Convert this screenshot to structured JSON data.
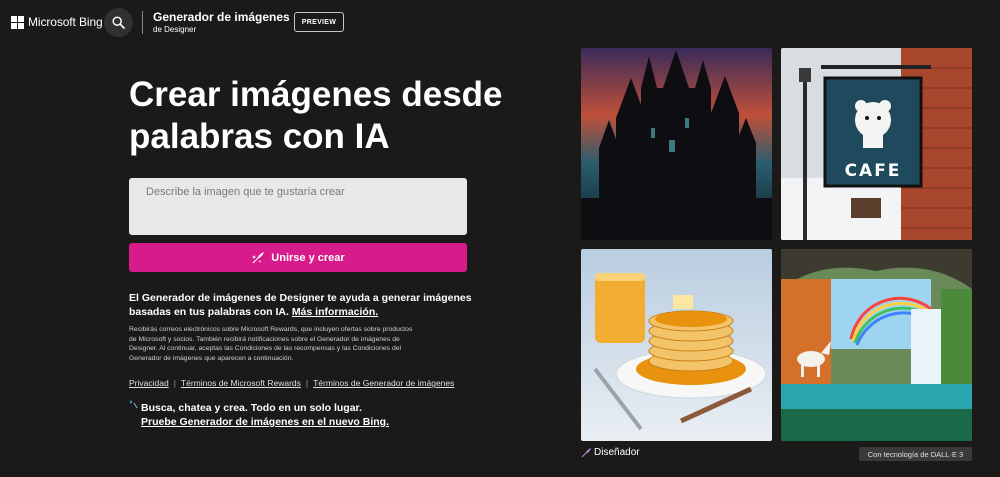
{
  "header": {
    "brand": "Microsoft Bing",
    "app_title": "Generador de imágenes",
    "app_subtitle": "de Designer",
    "preview_badge": "PREVIEW"
  },
  "hero": {
    "title": "Crear imágenes desde palabras con IA",
    "prompt_placeholder": "Describe la imagen que te gustaría crear",
    "join_button": "Unirse y crear"
  },
  "description": {
    "text": "El Generador de imágenes de Designer te ayuda a generar imágenes basadas en tus palabras con IA.",
    "link": "Más información."
  },
  "small_print": "Recibirás correos electrónicos sobre Microsoft Rewards, que incluyen ofertas sobre productos de Microsoft y socios. También recibirá notificaciones sobre el Generador de imágenes de Designer. Al continuar, aceptas las Condiciones de las recompensas y las Condiciones del Generador de imágenes que aparecen a continuación.",
  "footer_links": {
    "privacy": "Privacidad",
    "rewards_terms": "Términos de Microsoft Rewards",
    "generator_terms": "Términos de Generador de imágenes",
    "separator": "|"
  },
  "promo": {
    "line1": "Busca, chatea y crea. Todo en un solo lugar.",
    "line2": "Pruebe Generador de imágenes en el nuevo Bing."
  },
  "gallery": {
    "cafe_sign": "CAFE",
    "designer_label": "Diseñador",
    "dalle_badge": "Con tecnología de DALL·E 3"
  },
  "colors": {
    "background": "#1b1a19",
    "accent": "#d81b8b",
    "prompt_bg": "#e8e8e8"
  },
  "icons": {
    "search": "search-icon",
    "sparkle_brush": "create-icon",
    "designer": "designer-icon",
    "promo": "sparkle-icon"
  }
}
